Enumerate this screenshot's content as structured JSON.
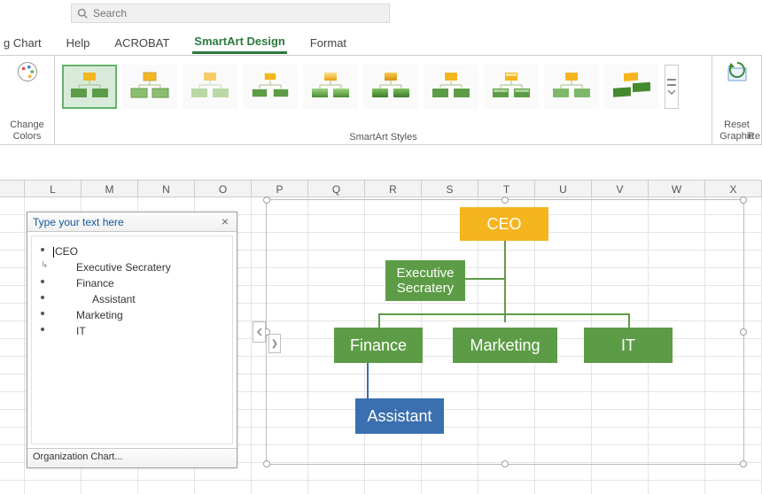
{
  "search": {
    "placeholder": "Search"
  },
  "tabs": {
    "chart": "g Chart",
    "help": "Help",
    "acrobat": "ACROBAT",
    "smartart": "SmartArt Design",
    "format": "Format"
  },
  "ribbon": {
    "change_colors": "Change\nColors",
    "styles_label": "SmartArt Styles",
    "reset": "Reset\nGraphic",
    "reset_short": "Re"
  },
  "columns": [
    "L",
    "M",
    "N",
    "O",
    "P",
    "Q",
    "R",
    "S",
    "T",
    "U",
    "V",
    "W",
    "X"
  ],
  "text_pane": {
    "title": "Type your text here",
    "items": [
      {
        "text": "CEO",
        "level": 0,
        "cursor": true,
        "marker": "bullet"
      },
      {
        "text": "Executive Secratery",
        "level": 1,
        "marker": "arrow"
      },
      {
        "text": "Finance",
        "level": 1,
        "marker": "bullet"
      },
      {
        "text": "Assistant",
        "level": 2,
        "marker": "bullet"
      },
      {
        "text": "Marketing",
        "level": 1,
        "marker": "bullet"
      },
      {
        "text": "IT",
        "level": 1,
        "marker": "bullet"
      }
    ],
    "footer": "Organization Chart..."
  },
  "smartart": {
    "ceo": "CEO",
    "exec": "Executive\nSecratery",
    "finance": "Finance",
    "marketing": "Marketing",
    "it": "IT",
    "assistant": "Assistant"
  }
}
